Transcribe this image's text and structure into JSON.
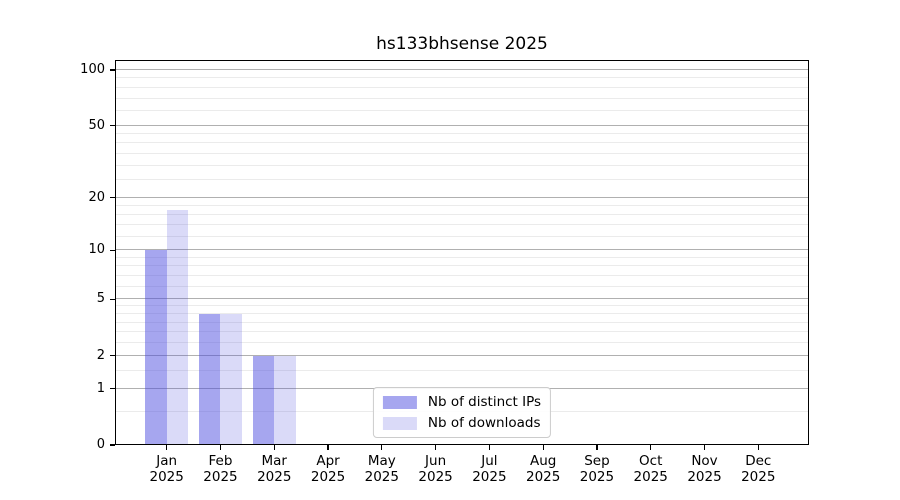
{
  "title": "hs133bhsense 2025",
  "chart_data": {
    "type": "bar",
    "title": "hs133bhsense 2025",
    "categories": [
      "Jan",
      "Feb",
      "Mar",
      "Apr",
      "May",
      "Jun",
      "Jul",
      "Aug",
      "Sep",
      "Oct",
      "Nov",
      "Dec"
    ],
    "x_year_label": "2025",
    "series": [
      {
        "key": "distinct-ips",
        "name": "Nb of distinct IPs",
        "color": "rgba(68,68,221,0.48)",
        "values": [
          10,
          4,
          2,
          0,
          0,
          0,
          0,
          0,
          0,
          0,
          0,
          0
        ]
      },
      {
        "key": "downloads",
        "name": "Nb of downloads",
        "color": "rgba(68,68,221,0.20)",
        "values": [
          17,
          4,
          2,
          0,
          0,
          0,
          0,
          0,
          0,
          0,
          0,
          0
        ]
      }
    ],
    "y_axis": {
      "scale": "log1p",
      "ticks": [
        0,
        1,
        2,
        5,
        10,
        20,
        50,
        100
      ],
      "minor_ticks": [
        0.5,
        1.5,
        2.5,
        3,
        3.5,
        4,
        4.5,
        6,
        7,
        8,
        9,
        12,
        14,
        16,
        18,
        25,
        30,
        35,
        40,
        45,
        60,
        70,
        80,
        90
      ],
      "ylim": [
        0,
        100
      ]
    },
    "xlabel": "",
    "ylabel": "",
    "grid": true,
    "legend_position": "lower center",
    "colors": {
      "major_grid": "#b0b0b0",
      "minor_grid": "#ebebeb",
      "axis": "#000000",
      "legend_border": "#cccccc"
    }
  }
}
